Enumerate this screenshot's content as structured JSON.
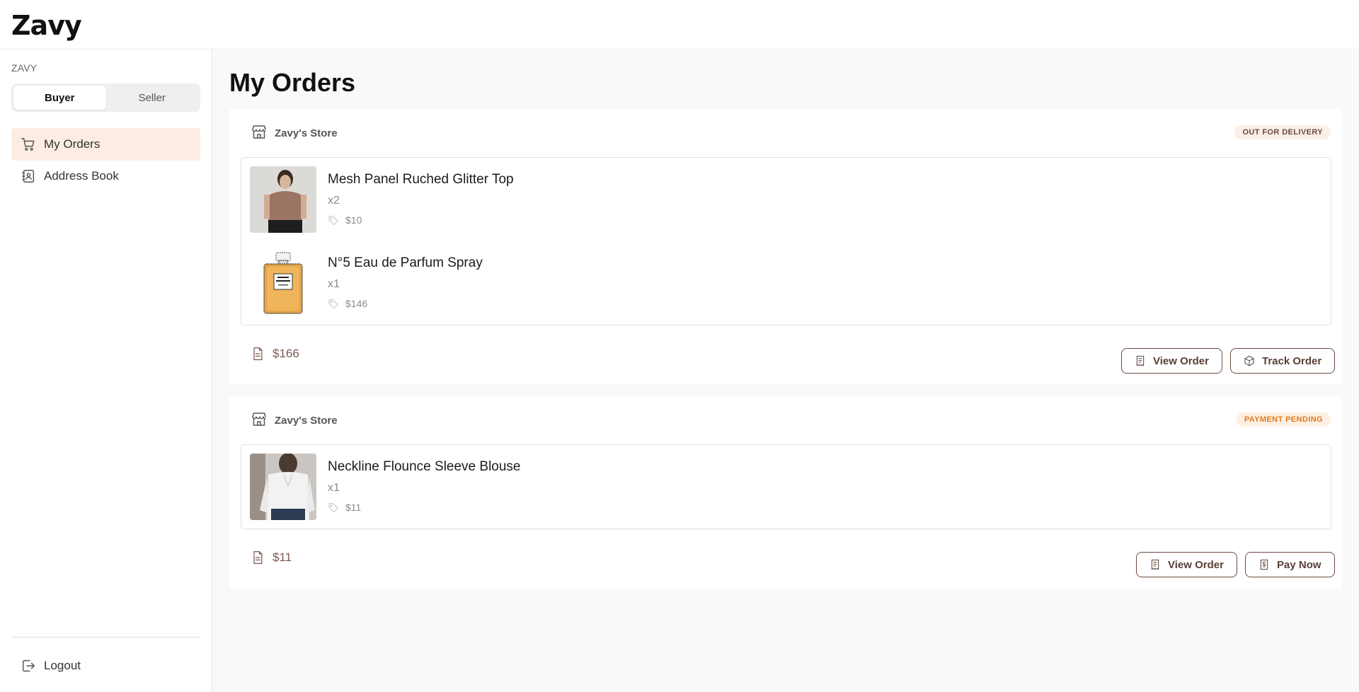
{
  "app": {
    "logo": "Zavy"
  },
  "sidebar": {
    "brand_label": "ZAVY",
    "roles": [
      "Buyer",
      "Seller"
    ],
    "active_role": "Buyer",
    "items": [
      {
        "label": "My Orders",
        "icon": "cart-icon",
        "active": true
      },
      {
        "label": "Address Book",
        "icon": "address-book-icon",
        "active": false
      }
    ],
    "logout_label": "Logout"
  },
  "main": {
    "title": "My Orders",
    "orders": [
      {
        "store": "Zavy's Store",
        "status": "OUT FOR DELIVERY",
        "items": [
          {
            "name": "Mesh Panel Ruched Glitter Top",
            "qty": "x2",
            "price": "$10"
          },
          {
            "name": "N°5 Eau de Parfum Spray",
            "qty": "x1",
            "price": "$146"
          }
        ],
        "total": "$166",
        "actions": [
          "View Order",
          "Track Order"
        ]
      },
      {
        "store": "Zavy's Store",
        "status": "PAYMENT PENDING",
        "items": [
          {
            "name": "Neckline Flounce Sleeve Blouse",
            "qty": "x1",
            "price": "$11"
          }
        ],
        "total": "$11",
        "actions": [
          "View Order",
          "Pay Now"
        ]
      }
    ]
  },
  "colors": {
    "accent": "#6b4a3e",
    "active_nav_bg": "#fdece4",
    "pending": "#e07a1f",
    "page_bg": "#f8f9fa"
  }
}
